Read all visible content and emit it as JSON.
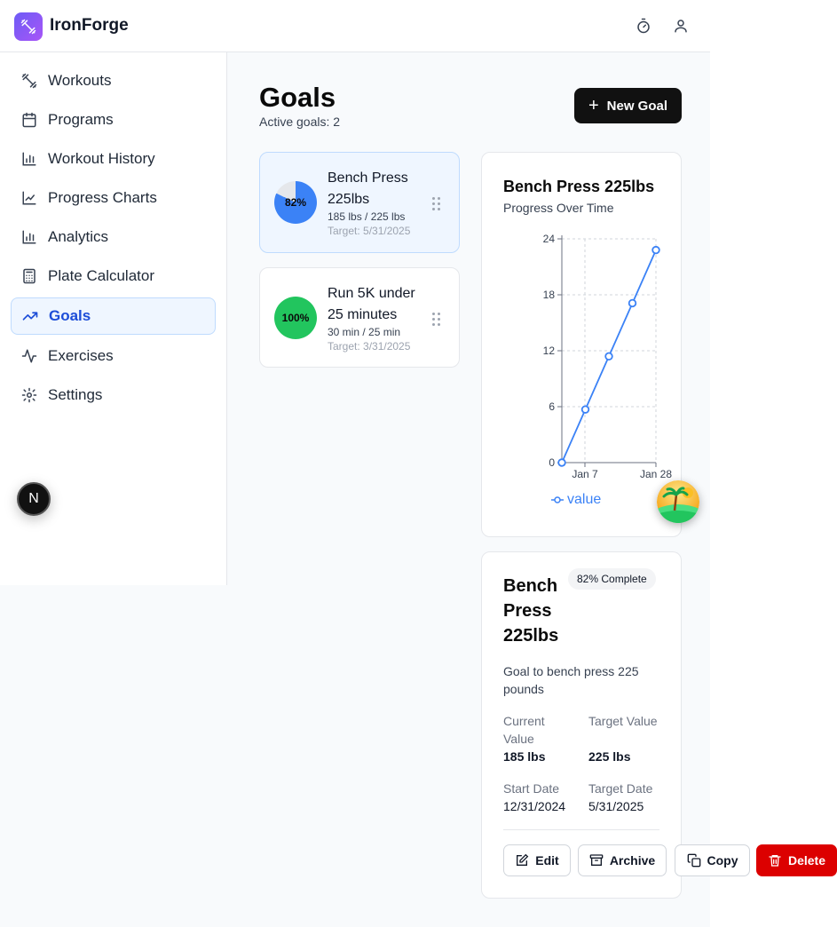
{
  "app": {
    "title": "IronForge"
  },
  "header": {
    "icons": [
      "timer-icon",
      "user-icon"
    ]
  },
  "sidebar": {
    "items": [
      {
        "label": "Workouts",
        "icon": "dumbbell-icon"
      },
      {
        "label": "Programs",
        "icon": "calendar-icon"
      },
      {
        "label": "Workout History",
        "icon": "bar-chart-icon"
      },
      {
        "label": "Progress Charts",
        "icon": "line-chart-icon"
      },
      {
        "label": "Analytics",
        "icon": "bar-chart-icon"
      },
      {
        "label": "Plate Calculator",
        "icon": "calculator-icon"
      },
      {
        "label": "Goals",
        "icon": "trending-up-icon",
        "active": true
      },
      {
        "label": "Exercises",
        "icon": "activity-icon"
      },
      {
        "label": "Settings",
        "icon": "gear-icon"
      }
    ],
    "badge": "N"
  },
  "main": {
    "title": "Goals",
    "subtitle": "Active goals: 2",
    "new_goal_label": "New Goal",
    "goals": [
      {
        "percent_label": "82%",
        "percent": 82,
        "name": "Bench Press 225lbs",
        "progress": "185 lbs / 225 lbs",
        "target": "Target: 5/31/2025",
        "color": "#3b82f6"
      },
      {
        "percent_label": "100%",
        "percent": 100,
        "name": "Run 5K under 25 minutes",
        "progress": "30 min / 25 min",
        "target": "Target: 3/31/2025",
        "color": "#22c55e"
      }
    ]
  },
  "chart_panel": {
    "title": "Bench Press 225lbs",
    "subtitle": "Progress Over Time",
    "legend_label": "value"
  },
  "chart_data": {
    "type": "line",
    "title": "",
    "xlabel": "",
    "ylabel": "",
    "x_ticks": [
      "Jan 7",
      "Jan 28"
    ],
    "y_ticks": [
      0,
      6,
      12,
      18,
      24
    ],
    "ylim": [
      0,
      24
    ],
    "grid": true,
    "legend": "bottom",
    "series": [
      {
        "name": "value",
        "color": "#3b82f6",
        "values": [
          0,
          5.7,
          11.4,
          17.1,
          22.8
        ]
      }
    ]
  },
  "details": {
    "title": "Bench Press 225lbs",
    "badge": "82% Complete",
    "description": "Goal to bench press 225 pounds",
    "current_label": "Current Value",
    "current_value": "185 lbs",
    "target_label": "Target Value",
    "target_value": "225 lbs",
    "start_label": "Start Date",
    "start_value": "12/31/2024",
    "target_date_label": "Target Date",
    "target_date_value": "5/31/2025",
    "edit_label": "Edit",
    "archive_label": "Archive",
    "copy_label": "Copy",
    "delete_label": "Delete"
  }
}
